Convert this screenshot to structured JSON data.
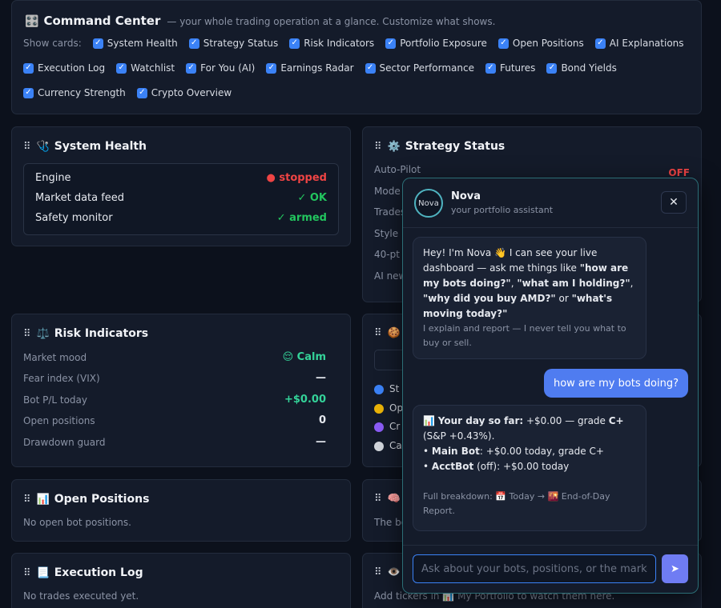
{
  "command_center": {
    "icon": "🎛️",
    "title": "Command Center",
    "subtitle": "— your whole trading operation at a glance. Customize what shows.",
    "show_label": "Show cards:",
    "cards": [
      {
        "label": "System Health",
        "checked": true
      },
      {
        "label": "Strategy Status",
        "checked": true
      },
      {
        "label": "Risk Indicators",
        "checked": true
      },
      {
        "label": "Portfolio Exposure",
        "checked": true
      },
      {
        "label": "Open Positions",
        "checked": true
      },
      {
        "label": "AI Explanations",
        "checked": true
      },
      {
        "label": "Execution Log",
        "checked": true
      },
      {
        "label": "Watchlist",
        "checked": true
      },
      {
        "label": "For You (AI)",
        "checked": true
      },
      {
        "label": "Earnings Radar",
        "checked": true
      },
      {
        "label": "Sector Performance",
        "checked": true
      },
      {
        "label": "Futures",
        "checked": true
      },
      {
        "label": "Bond Yields",
        "checked": true
      },
      {
        "label": "Currency Strength",
        "checked": true
      },
      {
        "label": "Crypto Overview",
        "checked": true
      }
    ]
  },
  "system_health": {
    "icon": "🩺",
    "title": "System Health",
    "rows": [
      {
        "label": "Engine",
        "value": "● stopped",
        "color": "#ef4444"
      },
      {
        "label": "Market data feed",
        "value": "✓ OK",
        "color": "#22c55e"
      },
      {
        "label": "Safety monitor",
        "value": "✓ armed",
        "color": "#22c55e"
      }
    ]
  },
  "strategy_status": {
    "icon": "⚙️",
    "title": "Strategy Status",
    "autopilot_label": "Auto-Pilot",
    "autopilot_value": "OFF",
    "rows": [
      "Mode",
      "Trades",
      "Style",
      "40-pt",
      "AI new"
    ]
  },
  "risk_indicators": {
    "icon": "⚖️",
    "title": "Risk Indicators",
    "rows": [
      {
        "label": "Market mood",
        "value": "😌 Calm",
        "color": "#34d399"
      },
      {
        "label": "Fear index (VIX)",
        "value": "—",
        "color": "#e6e9ef"
      },
      {
        "label": "Bot P/L today",
        "value": "+$0.00",
        "color": "#34d399"
      },
      {
        "label": "Open positions",
        "value": "0",
        "color": "#e6e9ef"
      },
      {
        "label": "Drawdown guard",
        "value": "—",
        "color": "#e6e9ef"
      }
    ]
  },
  "sector_card": {
    "icon": "🍪",
    "items": [
      {
        "label": "St",
        "color": "#3b82f6"
      },
      {
        "label": "Op",
        "color": "#eab308"
      },
      {
        "label": "Cr",
        "color": "#8b5cf6"
      },
      {
        "label": "Ca",
        "color": "#d1d5db"
      }
    ]
  },
  "open_positions": {
    "icon": "📊",
    "title": "Open Positions",
    "empty": "No open bot positions."
  },
  "ai_card": {
    "icon": "🧠",
    "text": "The bo"
  },
  "execution_log": {
    "icon": "📃",
    "title": "Execution Log",
    "empty": "No trades executed yet."
  },
  "watchlist": {
    "icon": "👁️",
    "text": "Add tickers in 📊 My Portfolio to watch them here."
  },
  "chat": {
    "name": "Nova",
    "subtitle": "your portfolio assistant",
    "avatar_alt": "Nova",
    "close": "✕",
    "greeting_pre": "Hey! I'm Nova 👋 I can see your live dashboard — ask me things like ",
    "greeting_q1": "\"how are my bots doing?\"",
    "greeting_sep1": ", ",
    "greeting_q2": "\"what am I holding?\"",
    "greeting_sep2": ", ",
    "greeting_q3": "\"why did you buy AMD?\"",
    "greeting_or": " or ",
    "greeting_q4": "\"what's moving today?\"",
    "greeting_note": "I explain and report — I never tell you what to buy or sell.",
    "user_message": "how are my bots doing?",
    "reply_icon": "📊",
    "reply_title": "Your day so far:",
    "reply_line1": " +$0.00 — grade ",
    "reply_grade": "C+",
    "reply_line1b": "(S&P +0.43%).",
    "reply_bot1_name": "Main Bot",
    "reply_bot1_text": ": +$0.00 today, grade C+",
    "reply_bot2_name": "AcctBot",
    "reply_bot2_text": " (off): +$0.00 today",
    "reply_footer": "Full breakdown: 📅 Today → 🌇 End-of-Day Report.",
    "input_placeholder": "Ask about your bots, positions, or the market...",
    "send_icon": "➤"
  }
}
